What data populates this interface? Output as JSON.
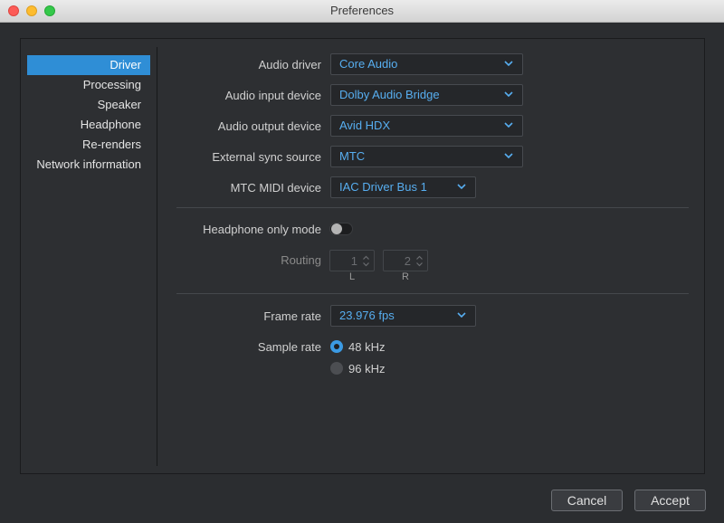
{
  "window": {
    "title": "Preferences"
  },
  "sidebar": {
    "items": [
      {
        "label": "Driver",
        "active": true
      },
      {
        "label": "Processing"
      },
      {
        "label": "Speaker"
      },
      {
        "label": "Headphone"
      },
      {
        "label": "Re-renders"
      },
      {
        "label": "Network information"
      }
    ]
  },
  "driver": {
    "audio_driver": {
      "label": "Audio driver",
      "value": "Core Audio"
    },
    "audio_input_device": {
      "label": "Audio input device",
      "value": "Dolby Audio Bridge"
    },
    "audio_output_device": {
      "label": "Audio output device",
      "value": "Avid HDX"
    },
    "external_sync_source": {
      "label": "External sync source",
      "value": "MTC"
    },
    "mtc_midi_device": {
      "label": "MTC MIDI device",
      "value": "IAC Driver Bus 1"
    }
  },
  "headphone": {
    "only_mode_label": "Headphone only mode",
    "only_mode_on": false,
    "routing_label": "Routing",
    "left_value": "1",
    "right_value": "2",
    "left_label": "L",
    "right_label": "R"
  },
  "timing": {
    "frame_rate": {
      "label": "Frame rate",
      "value": "23.976 fps"
    },
    "sample_rate": {
      "label": "Sample rate",
      "options": [
        {
          "label": "48 kHz",
          "selected": true
        },
        {
          "label": "96 kHz",
          "selected": false
        }
      ]
    }
  },
  "buttons": {
    "cancel": "Cancel",
    "accept": "Accept"
  },
  "colors": {
    "accent": "#2f8ed6",
    "select_text": "#57aef0",
    "background": "#2b2d30"
  }
}
